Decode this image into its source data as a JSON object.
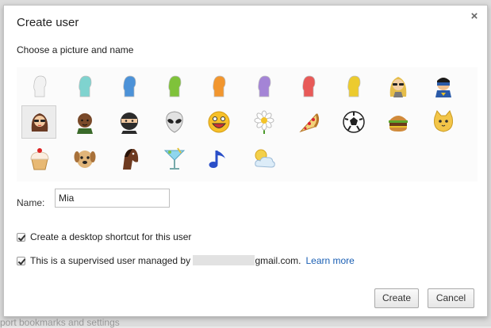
{
  "background": {
    "text": "port bookmarks and settings"
  },
  "dialog": {
    "title": "Create user",
    "close_glyph": "×",
    "subtitle": "Choose a picture and name",
    "avatars": [
      {
        "name": "white-silhouette-avatar",
        "color": "#f2f2f2"
      },
      {
        "name": "teal-silhouette-avatar",
        "color": "#7fd3cf"
      },
      {
        "name": "blue-silhouette-avatar",
        "color": "#4c92d8"
      },
      {
        "name": "green-silhouette-avatar",
        "color": "#7fc23a"
      },
      {
        "name": "orange-silhouette-avatar",
        "color": "#f2962e"
      },
      {
        "name": "purple-silhouette-avatar",
        "color": "#a484d6"
      },
      {
        "name": "red-silhouette-avatar",
        "color": "#e85a58"
      },
      {
        "name": "yellow-silhouette-avatar",
        "color": "#eccb2e"
      },
      {
        "name": "blonde-sunglasses-avatar",
        "color": "#d4a93c"
      },
      {
        "name": "superhero-avatar",
        "color": "#2a5aa8"
      },
      {
        "name": "woman-sunglasses-avatar",
        "color": "#6a3b24"
      },
      {
        "name": "man-avatar",
        "color": "#5a3318"
      },
      {
        "name": "ninja-avatar",
        "color": "#2b2b2b"
      },
      {
        "name": "alien-avatar",
        "color": "#d8d8d8"
      },
      {
        "name": "smiley-avatar",
        "color": "#f6c02a"
      },
      {
        "name": "flower-avatar",
        "color": "#f5f5f5"
      },
      {
        "name": "pizza-avatar",
        "color": "#e3a550"
      },
      {
        "name": "soccer-ball-avatar",
        "color": "#222222"
      },
      {
        "name": "burger-avatar",
        "color": "#b5752f"
      },
      {
        "name": "cat-avatar",
        "color": "#f3c548"
      },
      {
        "name": "cupcake-avatar",
        "color": "#f1d8a8"
      },
      {
        "name": "dog-avatar",
        "color": "#c99c62"
      },
      {
        "name": "horse-avatar",
        "color": "#6e3a20"
      },
      {
        "name": "cocktail-avatar",
        "color": "#7fd0e8"
      },
      {
        "name": "music-note-avatar",
        "color": "#2a4fc8"
      },
      {
        "name": "sun-cloud-avatar",
        "color": "#f3d04a"
      }
    ],
    "selected_avatar": "woman-sunglasses-avatar",
    "name_label": "Name:",
    "name_value": "Mia",
    "shortcut_checkbox": {
      "label": "Create a desktop shortcut for this user",
      "checked": true
    },
    "supervised_checkbox": {
      "label_prefix": "This is a supervised user managed by",
      "label_suffix": "gmail.com.",
      "learn_more": "Learn more",
      "checked": true
    },
    "create_button": "Create",
    "cancel_button": "Cancel"
  }
}
